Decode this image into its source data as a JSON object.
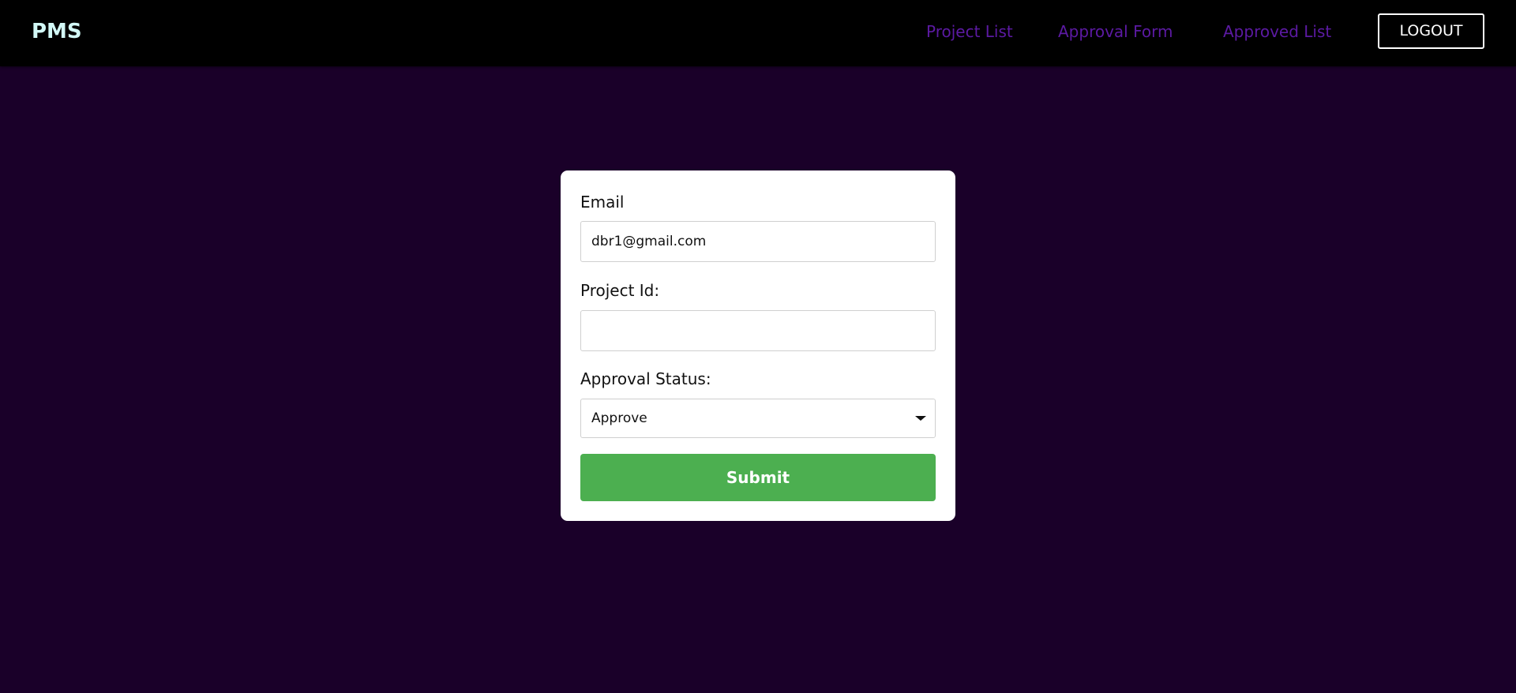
{
  "navbar": {
    "brand": "PMS",
    "links": [
      {
        "label": "Project List"
      },
      {
        "label": "Approval Form"
      },
      {
        "label": "Approved List"
      }
    ],
    "logout_label": "LOGOUT"
  },
  "form": {
    "email": {
      "label": "Email",
      "value": "dbr1@gmail.com"
    },
    "project_id": {
      "label": "Project Id:",
      "value": ""
    },
    "approval_status": {
      "label": "Approval Status:",
      "selected": "Approve"
    },
    "submit_label": "Submit"
  },
  "colors": {
    "page_background": "#1a0029",
    "navbar_background": "#000000",
    "brand": "#d2f8f6",
    "nav_link": "#5c1aa3",
    "submit_button": "#4caf50",
    "card": "#ffffff"
  },
  "icons": {
    "select_caret": "caret-down-icon"
  }
}
